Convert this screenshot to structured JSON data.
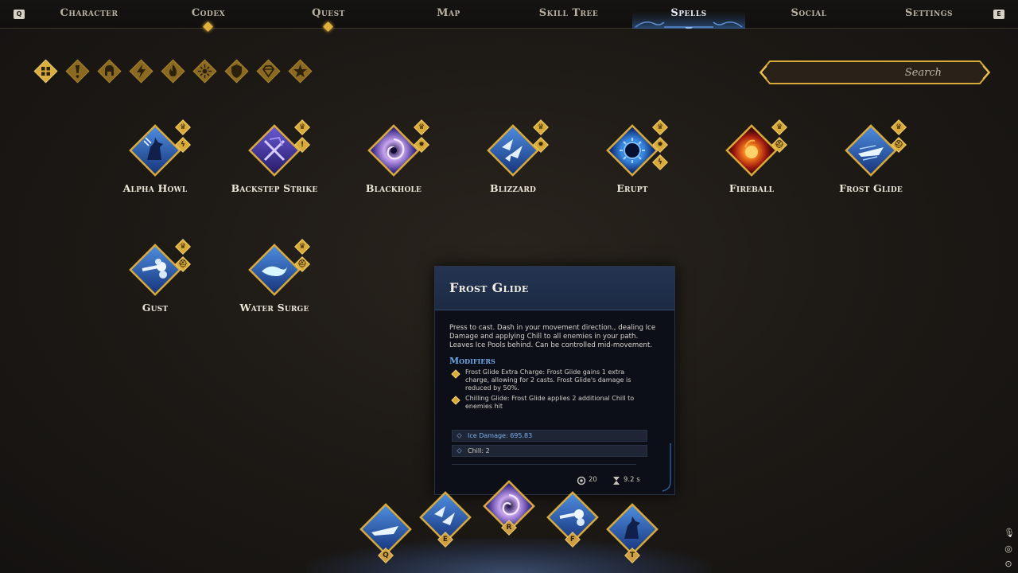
{
  "nav": {
    "left_key": "Q",
    "right_key": "E",
    "tabs": [
      {
        "label": "Character"
      },
      {
        "label": "Codex"
      },
      {
        "label": "Quest"
      },
      {
        "label": "Map"
      },
      {
        "label": "Skill Tree"
      },
      {
        "label": "Spells"
      },
      {
        "label": "Social"
      },
      {
        "label": "Settings"
      }
    ],
    "active_tab": "Spells"
  },
  "filters": [
    {
      "icon": "all-grid-icon"
    },
    {
      "icon": "exclamation-icon"
    },
    {
      "icon": "helmet-icon"
    },
    {
      "icon": "lightning-icon"
    },
    {
      "icon": "flame-icon"
    },
    {
      "icon": "sun-burst-icon"
    },
    {
      "icon": "shield-icon"
    },
    {
      "icon": "gem-icon"
    },
    {
      "icon": "star-icon"
    }
  ],
  "search": {
    "placeholder": "Search"
  },
  "spells": [
    {
      "name": "Alpha Howl",
      "badges": [
        "crown-icon",
        "lightning-icon"
      ]
    },
    {
      "name": "Backstep Strike",
      "badges": [
        "crown-icon",
        "exclamation-icon"
      ]
    },
    {
      "name": "Blackhole",
      "badges": [
        "crown-icon",
        "sun-burst-icon"
      ]
    },
    {
      "name": "Blizzard",
      "badges": [
        "crown-icon",
        "sun-burst-icon"
      ]
    },
    {
      "name": "Erupt",
      "badges": [
        "crown-icon",
        "sun-burst-icon",
        "lightning-icon"
      ]
    },
    {
      "name": "Fireball",
      "badges": [
        "crown-icon",
        "helmet-icon"
      ]
    },
    {
      "name": "Frost Glide",
      "badges": [
        "crown-icon",
        "helmet-icon"
      ]
    },
    {
      "name": "Gust",
      "badges": [
        "crown-icon",
        "helmet-icon"
      ]
    },
    {
      "name": "Water Surge",
      "badges": [
        "crown-icon",
        "helmet-icon"
      ]
    }
  ],
  "tooltip": {
    "title": "Frost Glide",
    "description": "Press to cast. Dash in your movement direction., dealing Ice Damage and applying Chill to all enemies in your path. Leaves Ice Pools behind. Can be controlled mid-movement.",
    "modifiers_heading": "Modifiers",
    "modifiers": [
      {
        "text": "Frost Glide Extra Charge: Frost Glide gains 1 extra charge, allowing for 2 casts. Frost Glide's damage is reduced by 50%."
      },
      {
        "text": "Chilling Glide: Frost Glide applies 2 additional Chill to enemies hit"
      }
    ],
    "stats": [
      {
        "text": "Ice Damage: 695.83"
      },
      {
        "text": "Chill: 2"
      }
    ],
    "mana_cost": "20",
    "cooldown": "9.2 s"
  },
  "hotbar": [
    {
      "key": "Q",
      "spell": "Frost Glide"
    },
    {
      "key": "E",
      "spell": "Blizzard"
    },
    {
      "key": "R",
      "spell": "Blackhole"
    },
    {
      "key": "F",
      "spell": "Gust"
    },
    {
      "key": "T",
      "spell": "Alpha Howl"
    }
  ],
  "colors": {
    "gold": "#d8aa3a",
    "active_blue": "#6fa8e8",
    "tooltip_header": "#243451"
  }
}
